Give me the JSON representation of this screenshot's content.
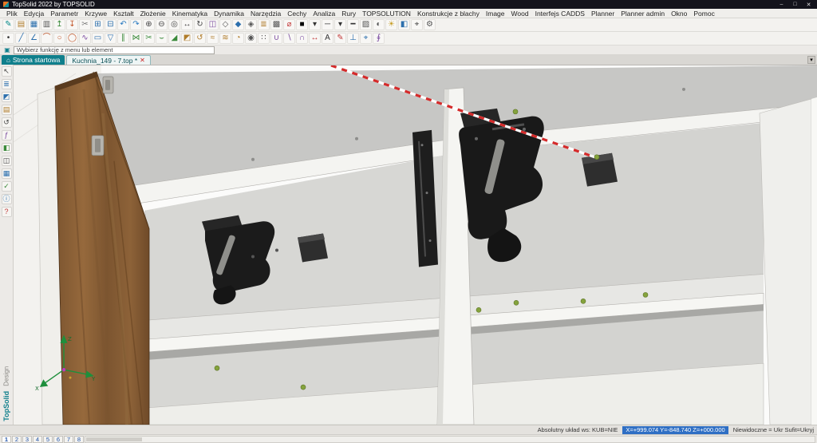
{
  "colors": {
    "accent_teal": "#0f7f8c",
    "titlebar_bg": "#14141c",
    "selection_blue": "#2f6fc4",
    "wood_brown": "#8c6239",
    "hardware_black": "#1b1b1b",
    "screw_green": "#85a33d",
    "axis_green": "#1e8f3c",
    "construction_red": "#d42a2a"
  },
  "title_bar": {
    "title": "TopSolid 2022 by TOPSOLID",
    "controls": {
      "minimize": "–",
      "maximize": "□",
      "close": "✕"
    }
  },
  "menu_bar": {
    "items": [
      "Plik",
      "Edycja",
      "Parametr",
      "Krzywe",
      "Kształt",
      "Złożenie",
      "Kinematyka",
      "Dynamika",
      "Narzędzia",
      "Cechy",
      "Analiza",
      "Rury",
      "TOPSOLUTION",
      "Konstrukcje z blachy",
      "Image",
      "Wood",
      "Interfejs CADDS",
      "Planner",
      "Planner admin",
      "Okno",
      "Pomoc"
    ]
  },
  "toolbar_row1": [
    {
      "name": "pencil-icon",
      "glyph": "✎",
      "color": "#0a8a8a"
    },
    {
      "name": "open-icon",
      "glyph": "▤",
      "color": "#b07c2a"
    },
    {
      "name": "save-icon",
      "glyph": "▦",
      "color": "#2c6fad"
    },
    {
      "name": "print-icon",
      "glyph": "▥",
      "color": "#555555"
    },
    {
      "name": "export-icon",
      "glyph": "↥",
      "color": "#3a8a3a"
    },
    {
      "name": "import-icon",
      "glyph": "↧",
      "color": "#c2572a"
    },
    {
      "name": "cut-icon",
      "glyph": "✂",
      "color": "#777777"
    },
    {
      "name": "copy-icon",
      "glyph": "⊞",
      "color": "#2c6fad"
    },
    {
      "name": "paste-icon",
      "glyph": "⊟",
      "color": "#2c6fad"
    },
    {
      "name": "undo-icon",
      "glyph": "↶",
      "color": "#2a7ac0"
    },
    {
      "name": "redo-icon",
      "glyph": "↷",
      "color": "#2a7ac0"
    },
    {
      "name": "zoom-in-icon",
      "glyph": "⊕",
      "color": "#444444"
    },
    {
      "name": "zoom-out-icon",
      "glyph": "⊖",
      "color": "#444444"
    },
    {
      "name": "zoom-fit-icon",
      "glyph": "◎",
      "color": "#444444"
    },
    {
      "name": "pan-icon",
      "glyph": "↔",
      "color": "#444444"
    },
    {
      "name": "rotate-view-icon",
      "glyph": "↻",
      "color": "#444444"
    },
    {
      "name": "view-cube-icon",
      "glyph": "◫",
      "color": "#7a4aa0"
    },
    {
      "name": "wireframe-icon",
      "glyph": "◇",
      "color": "#555555"
    },
    {
      "name": "shaded-icon",
      "glyph": "◆",
      "color": "#2c6fad"
    },
    {
      "name": "hidden-lines-icon",
      "glyph": "◈",
      "color": "#555555"
    },
    {
      "name": "layers-icon",
      "glyph": "≣",
      "color": "#b07c2a"
    },
    {
      "name": "grid-icon",
      "glyph": "▩",
      "color": "#555555"
    },
    {
      "name": "measure-icon",
      "glyph": "⌀",
      "color": "#c23a3a"
    },
    {
      "name": "color-swatch-icon",
      "glyph": "■",
      "color": "#000000"
    },
    {
      "name": "swatch-dropdown-icon",
      "glyph": "▾",
      "color": "#333333"
    },
    {
      "name": "line-style-icon",
      "glyph": "─",
      "color": "#333333"
    },
    {
      "name": "line-style-dropdown-icon",
      "glyph": "▾",
      "color": "#333333"
    },
    {
      "name": "line-weight-icon",
      "glyph": "━",
      "color": "#333333"
    },
    {
      "name": "hatch-icon",
      "glyph": "▨",
      "color": "#555555"
    },
    {
      "name": "transparency-icon",
      "glyph": "◐",
      "color": "#555555"
    },
    {
      "name": "light-icon",
      "glyph": "☀",
      "color": "#c8a02c"
    },
    {
      "name": "section-icon",
      "glyph": "◧",
      "color": "#2c6fad"
    },
    {
      "name": "camera-icon",
      "glyph": "⌖",
      "color": "#444444"
    },
    {
      "name": "settings-icon",
      "glyph": "⚙",
      "color": "#555555"
    }
  ],
  "toolbar_row2": [
    {
      "name": "point-icon",
      "glyph": "•",
      "color": "#333333"
    },
    {
      "name": "line-icon",
      "glyph": "╱",
      "color": "#2c6fad"
    },
    {
      "name": "polyline-icon",
      "glyph": "∠",
      "color": "#2c6fad"
    },
    {
      "name": "arc-icon",
      "glyph": "⌒",
      "color": "#c2572a"
    },
    {
      "name": "circle-icon",
      "glyph": "○",
      "color": "#c2572a"
    },
    {
      "name": "ellipse-icon",
      "glyph": "◯",
      "color": "#c2572a"
    },
    {
      "name": "spline-icon",
      "glyph": "∿",
      "color": "#7a4aa0"
    },
    {
      "name": "rectangle-icon",
      "glyph": "▭",
      "color": "#2c6fad"
    },
    {
      "name": "polygon-icon",
      "glyph": "▽",
      "color": "#2c6fad"
    },
    {
      "name": "offset-icon",
      "glyph": "∥",
      "color": "#3a8a3a"
    },
    {
      "name": "mirror-icon",
      "glyph": "⋈",
      "color": "#3a8a3a"
    },
    {
      "name": "trim-icon",
      "glyph": "✂",
      "color": "#3a8a3a"
    },
    {
      "name": "fillet-icon",
      "glyph": "⌣",
      "color": "#3a8a3a"
    },
    {
      "name": "chamfer-icon",
      "glyph": "◢",
      "color": "#3a8a3a"
    },
    {
      "name": "extrude-icon",
      "glyph": "◩",
      "color": "#b07c2a"
    },
    {
      "name": "revolve-icon",
      "glyph": "↺",
      "color": "#b07c2a"
    },
    {
      "name": "sweep-icon",
      "glyph": "≈",
      "color": "#b07c2a"
    },
    {
      "name": "loft-icon",
      "glyph": "≋",
      "color": "#b07c2a"
    },
    {
      "name": "shell-icon",
      "glyph": "◔",
      "color": "#b07c2a"
    },
    {
      "name": "hole-icon",
      "glyph": "◉",
      "color": "#555555"
    },
    {
      "name": "pattern-icon",
      "glyph": "∷",
      "color": "#555555"
    },
    {
      "name": "boolean-union-icon",
      "glyph": "∪",
      "color": "#7a4aa0"
    },
    {
      "name": "boolean-subtract-icon",
      "glyph": "∖",
      "color": "#7a4aa0"
    },
    {
      "name": "boolean-intersect-icon",
      "glyph": "∩",
      "color": "#7a4aa0"
    },
    {
      "name": "dimension-icon",
      "glyph": "↔",
      "color": "#c23a3a"
    },
    {
      "name": "text-icon",
      "glyph": "A",
      "color": "#333333"
    },
    {
      "name": "annotation-icon",
      "glyph": "✎",
      "color": "#c23a3a"
    },
    {
      "name": "constraint-icon",
      "glyph": "⊥",
      "color": "#2c6fad"
    },
    {
      "name": "snap-icon",
      "glyph": "⌖",
      "color": "#2c6fad"
    },
    {
      "name": "helix-icon",
      "glyph": "∮",
      "color": "#7a4aa0"
    }
  ],
  "prompt_bar": {
    "icon": "▣",
    "message": "Wybierz funkcję z menu lub element"
  },
  "tab_bar": {
    "overflow": "▾",
    "tabs": [
      {
        "label": "Strona startowa",
        "icon": "⌂"
      },
      {
        "label": "Kuchnia_149 - 7.top *",
        "close": "✕"
      }
    ]
  },
  "sidebar": {
    "icons": [
      {
        "name": "select-icon",
        "glyph": "↖",
        "color": "#444444"
      },
      {
        "name": "tree-icon",
        "glyph": "≣",
        "color": "#2c6fad"
      },
      {
        "name": "entities-icon",
        "glyph": "◩",
        "color": "#2c6fad"
      },
      {
        "name": "layers-panel-icon",
        "glyph": "▤",
        "color": "#b07c2a"
      },
      {
        "name": "history-icon",
        "glyph": "↺",
        "color": "#444444"
      },
      {
        "name": "parameters-icon",
        "glyph": "ƒ",
        "color": "#7a4aa0"
      },
      {
        "name": "materials-icon",
        "glyph": "◧",
        "color": "#3a8a3a"
      },
      {
        "name": "views-icon",
        "glyph": "◫",
        "color": "#444444"
      },
      {
        "name": "bom-icon",
        "glyph": "▦",
        "color": "#2c6fad"
      },
      {
        "name": "check-icon",
        "glyph": "✓",
        "color": "#3a8a3a"
      },
      {
        "name": "info-icon",
        "glyph": "ⓘ",
        "color": "#2c6fad"
      },
      {
        "name": "help-icon",
        "glyph": "?",
        "color": "#c23a3a"
      }
    ],
    "brand": {
      "name": "TopSolid",
      "product": "Design"
    }
  },
  "scene": {
    "axis": {
      "x_label": "X",
      "y_label": "Y",
      "z_label": "Z"
    }
  },
  "status_bar": {
    "label": "Absolutny układ ws: KUB=NIE",
    "coordinates": "X=+999.074   Y=-848.740   Z=+000.000",
    "visibility": "Niewidoczne = Ukr   Sufit=Ukryj"
  },
  "bottom_bar": {
    "pages": [
      "1",
      "2",
      "3",
      "4",
      "5",
      "6",
      "7",
      "8"
    ]
  }
}
